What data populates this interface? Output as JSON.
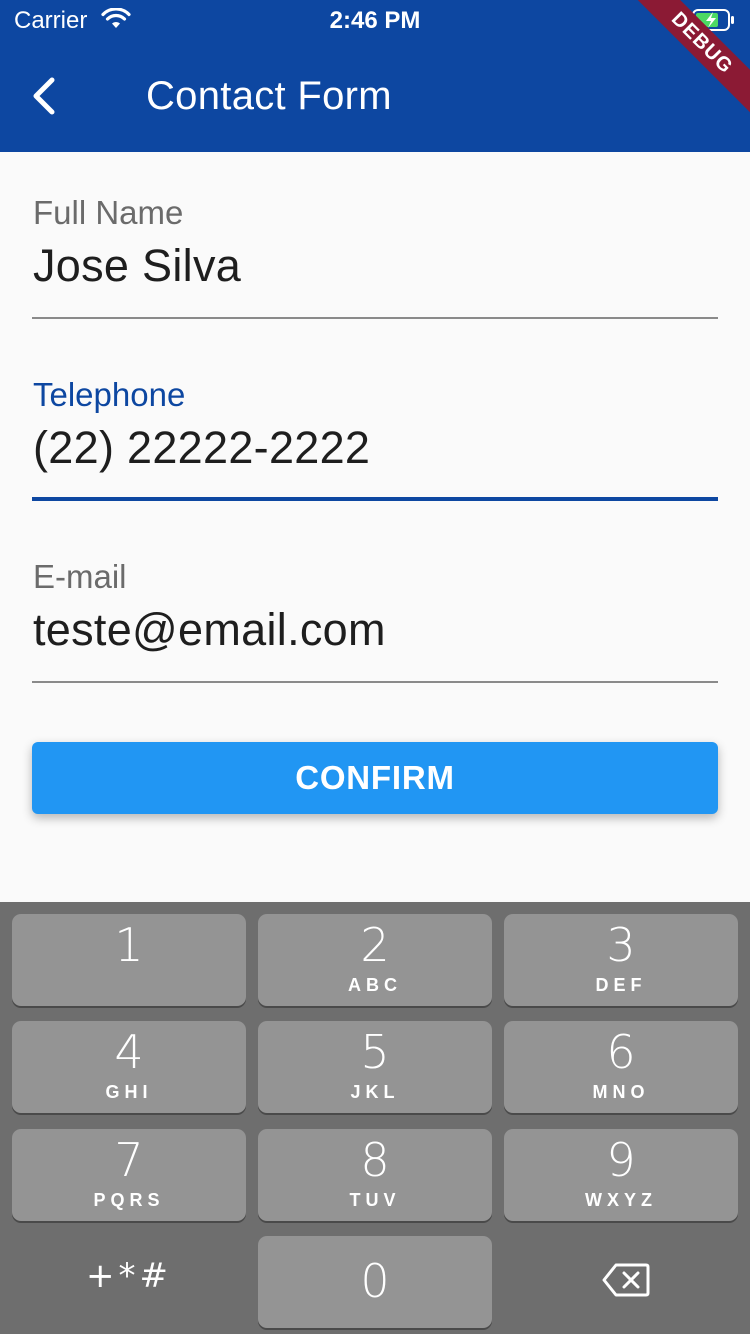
{
  "status_bar": {
    "carrier": "Carrier",
    "time": "2:46 PM"
  },
  "debug_banner": "DEBUG",
  "app_bar": {
    "title": "Contact Form"
  },
  "form": {
    "full_name": {
      "label": "Full Name",
      "value": "Jose Silva"
    },
    "telephone": {
      "label": "Telephone",
      "value": "(22) 22222-2222"
    },
    "email": {
      "label": "E-mail",
      "value": "teste@email.com"
    },
    "confirm_label": "CONFIRM"
  },
  "keyboard": {
    "keys": [
      {
        "digit": "1",
        "letters": ""
      },
      {
        "digit": "2",
        "letters": "ABC"
      },
      {
        "digit": "3",
        "letters": "DEF"
      },
      {
        "digit": "4",
        "letters": "GHI"
      },
      {
        "digit": "5",
        "letters": "JKL"
      },
      {
        "digit": "6",
        "letters": "MNO"
      },
      {
        "digit": "7",
        "letters": "PQRS"
      },
      {
        "digit": "8",
        "letters": "TUV"
      },
      {
        "digit": "9",
        "letters": "WXYZ"
      },
      {
        "digit": "0",
        "letters": ""
      }
    ],
    "symbols_label": "+*#"
  },
  "colors": {
    "app_bar": "#0d47a1",
    "accent": "#2196f3",
    "focus": "#0d47a1",
    "debug": "#8b1a34"
  },
  "icons": [
    "wifi-icon",
    "battery-charging-icon",
    "back-arrow-icon",
    "backspace-icon"
  ]
}
